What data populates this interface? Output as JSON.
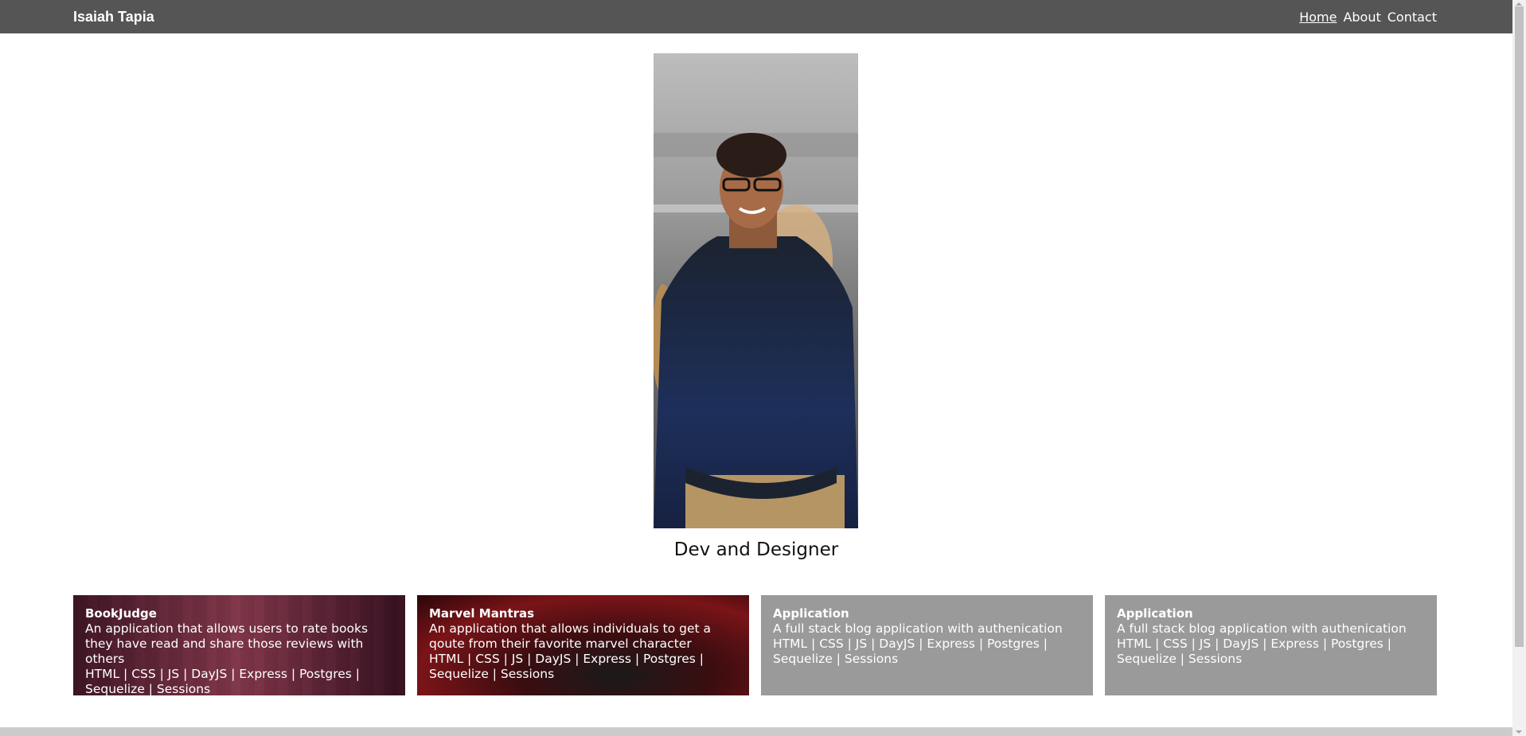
{
  "navbar": {
    "brand": "Isaiah Tapia",
    "links": [
      {
        "label": "Home",
        "active": true
      },
      {
        "label": "About",
        "active": false
      },
      {
        "label": "Contact",
        "active": false
      }
    ]
  },
  "hero": {
    "tagline": "Dev and Designer"
  },
  "projects": [
    {
      "title": "BookJudge",
      "description": "An application that allows users to rate books they have read and share those reviews with others",
      "tech": "HTML | CSS | JS | DayJS | Express | Postgres | Sequelize | Sessions"
    },
    {
      "title": "Marvel Mantras",
      "description": "An application that allows individuals to get a qoute from their favorite marvel character",
      "tech": "HTML | CSS | JS | DayJS | Express | Postgres | Sequelize | Sessions"
    },
    {
      "title": "Application",
      "description": "A full stack blog application with authenication",
      "tech": "HTML | CSS | JS | DayJS | Express | Postgres | Sequelize | Sessions"
    },
    {
      "title": "Application",
      "description": "A full stack blog application with authenication",
      "tech": "HTML | CSS | JS | DayJS | Express | Postgres | Sequelize | Sessions"
    }
  ],
  "colors": {
    "navbar": "#555555",
    "card_plain": "#9a9a9a"
  }
}
